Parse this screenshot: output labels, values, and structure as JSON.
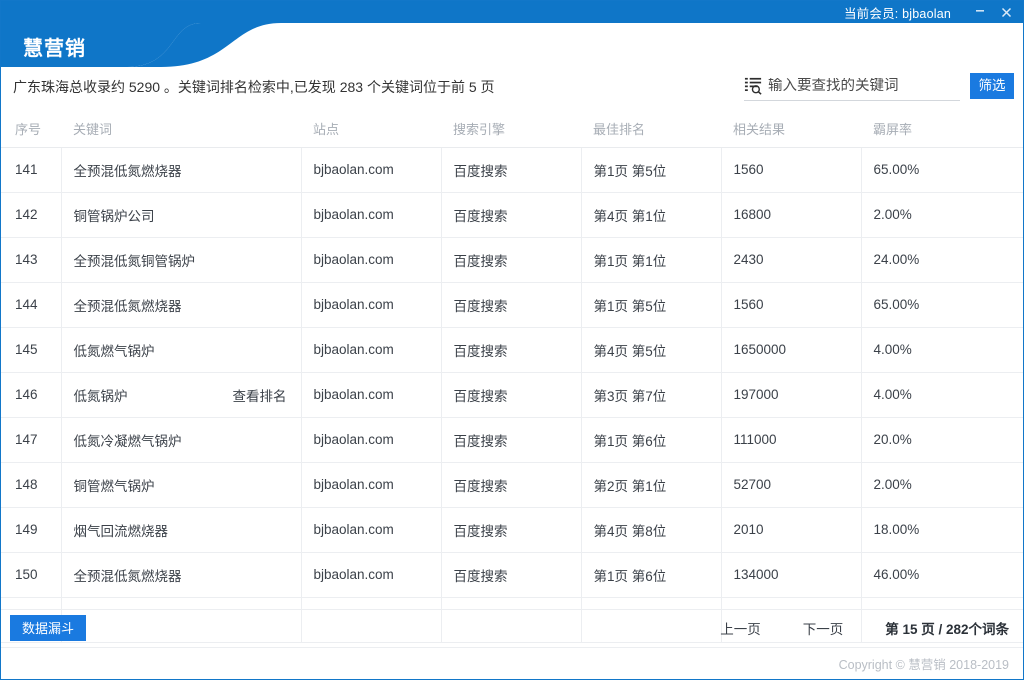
{
  "titlebar": {
    "member_label": "当前会员: bjbaolan",
    "minimize_label": "—",
    "close_label": "✕"
  },
  "header": {
    "brand": "慧营销"
  },
  "subheader": {
    "summary": "广东珠海总收录约 5290 。关键词排名检索中,已发现 283 个关键词位于前 5 页",
    "search_placeholder": "输入要查找的关键词",
    "search_value": "",
    "filter_label": "筛选",
    "search_icon": "list-search-icon"
  },
  "table": {
    "columns": [
      "序号",
      "关键词",
      "站点",
      "搜索引擎",
      "最佳排名",
      "相关结果",
      "霸屏率"
    ],
    "row_action_label": "查看排名",
    "rows": [
      {
        "index": "141",
        "keyword": "全预混低氮燃烧器",
        "action": "",
        "site": "bjbaolan.com",
        "engine": "百度搜索",
        "rank": "第1页 第5位",
        "results": "1560",
        "rate": "65.00%"
      },
      {
        "index": "142",
        "keyword": "铜管锅炉公司",
        "action": "",
        "site": "bjbaolan.com",
        "engine": "百度搜索",
        "rank": "第4页 第1位",
        "results": "16800",
        "rate": "2.00%"
      },
      {
        "index": "143",
        "keyword": "全预混低氮铜管锅炉",
        "action": "",
        "site": "bjbaolan.com",
        "engine": "百度搜索",
        "rank": "第1页 第1位",
        "results": "2430",
        "rate": "24.00%"
      },
      {
        "index": "144",
        "keyword": "全预混低氮燃烧器",
        "action": "",
        "site": "bjbaolan.com",
        "engine": "百度搜索",
        "rank": "第1页 第5位",
        "results": "1560",
        "rate": "65.00%"
      },
      {
        "index": "145",
        "keyword": "低氮燃气锅炉",
        "action": "",
        "site": "bjbaolan.com",
        "engine": "百度搜索",
        "rank": "第4页 第5位",
        "results": "1650000",
        "rate": "4.00%"
      },
      {
        "index": "146",
        "keyword": "低氮锅炉",
        "action": "查看排名",
        "site": "bjbaolan.com",
        "engine": "百度搜索",
        "rank": "第3页 第7位",
        "results": "197000",
        "rate": "4.00%"
      },
      {
        "index": "147",
        "keyword": "低氮冷凝燃气锅炉",
        "action": "",
        "site": "bjbaolan.com",
        "engine": "百度搜索",
        "rank": "第1页 第6位",
        "results": "111000",
        "rate": "20.0%"
      },
      {
        "index": "148",
        "keyword": "铜管燃气锅炉",
        "action": "",
        "site": "bjbaolan.com",
        "engine": "百度搜索",
        "rank": "第2页 第1位",
        "results": "52700",
        "rate": "2.00%"
      },
      {
        "index": "149",
        "keyword": "烟气回流燃烧器",
        "action": "",
        "site": "bjbaolan.com",
        "engine": "百度搜索",
        "rank": "第4页 第8位",
        "results": "2010",
        "rate": "18.00%"
      },
      {
        "index": "150",
        "keyword": "全预混低氮燃烧器",
        "action": "",
        "site": "bjbaolan.com",
        "engine": "百度搜索",
        "rank": "第1页 第6位",
        "results": "134000",
        "rate": "46.00%"
      }
    ]
  },
  "footer": {
    "funnel_label": "数据漏斗",
    "prev_label": "上一页",
    "next_label": "下一页",
    "page_info": "第 15 页 / 282个词条",
    "copyright": "Copyright © 慧营销 2018-2019"
  },
  "colors": {
    "titlebar_blue": "#0f76c8",
    "accent_blue": "#1a7ae0",
    "header_blue": "#0f76c8"
  }
}
